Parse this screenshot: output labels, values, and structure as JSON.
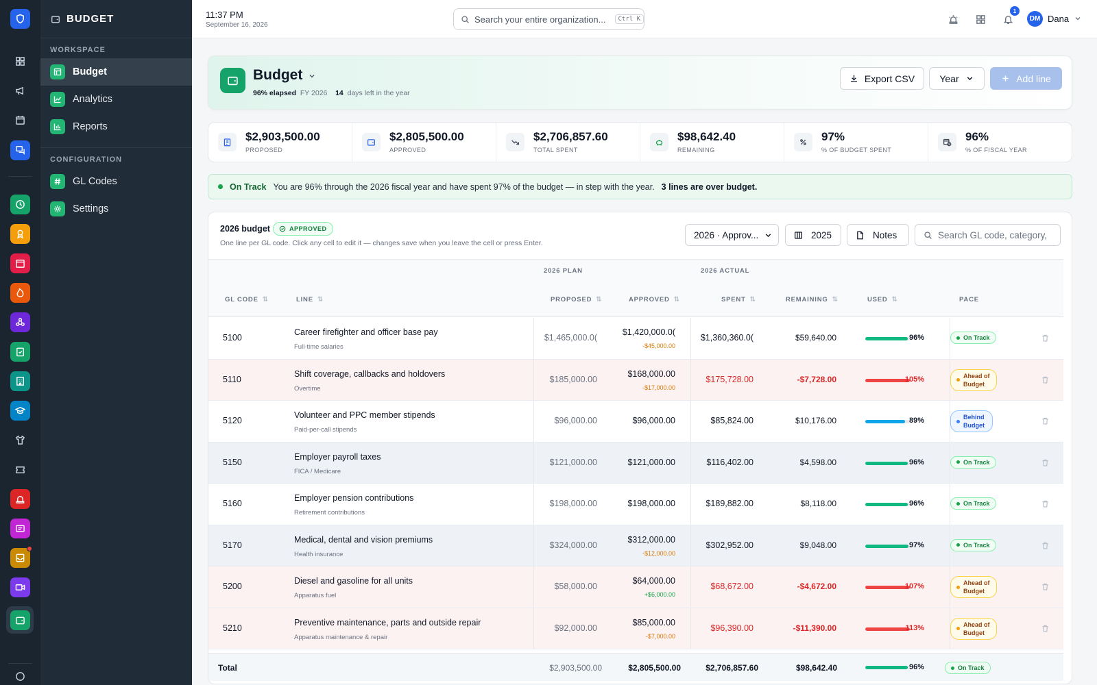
{
  "topbar": {
    "time": "11:37 PM",
    "date": "September 16, 2026",
    "search_placeholder": "Search your entire organization...",
    "search_shortcut": "Ctrl K",
    "notification_count": "1",
    "user_initials": "DM",
    "user_name": "Dana"
  },
  "nav": {
    "title": "BUDGET",
    "sections": [
      {
        "label": "WORKSPACE"
      },
      {
        "label": "CONFIGURATION"
      }
    ],
    "items": [
      {
        "label": "Budget"
      },
      {
        "label": "Analytics"
      },
      {
        "label": "Reports"
      },
      {
        "label": "GL Codes"
      },
      {
        "label": "Settings"
      }
    ]
  },
  "hero": {
    "title": "Budget",
    "elapsed": "96% elapsed",
    "fiscal_year": "FY 2026",
    "days_left": "14",
    "days_left_text": "days left in the year",
    "export_label": "Export CSV",
    "period_label": "Year",
    "add_label": "Add line"
  },
  "stats": [
    {
      "value": "$2,903,500.00",
      "label": "PROPOSED",
      "icon": "clipboard-icon"
    },
    {
      "value": "$2,805,500.00",
      "label": "APPROVED",
      "icon": "wallet-icon"
    },
    {
      "value": "$2,706,857.60",
      "label": "TOTAL SPENT",
      "icon": "trend-down-icon"
    },
    {
      "value": "$98,642.40",
      "label": "REMAINING",
      "icon": "piggy-bank-icon"
    },
    {
      "value": "97%",
      "label": "% OF BUDGET SPENT",
      "icon": "percent-icon"
    },
    {
      "value": "96%",
      "label": "% OF FISCAL YEAR",
      "icon": "calendar-clock-icon"
    }
  ],
  "alert": {
    "status": "On Track",
    "message": "You are 96% through the 2026 fiscal year and have spent 97% of the budget — in step with the year.",
    "over_budget": "3 lines are over budget."
  },
  "table_card": {
    "title": "2026 budget",
    "status_badge": "APPROVED",
    "subtitle": "One line per GL code. Click any cell to edit it — changes save when you leave the cell or press Enter.",
    "version_select": "2026 · Approv...",
    "compare_year": "2025",
    "notes_label": "Notes",
    "search_placeholder": "Search GL code, category,"
  },
  "table": {
    "group_plan": "2026 PLAN",
    "group_actual": "2026 ACTUAL",
    "headers": {
      "gl_code": "GL CODE",
      "line": "LINE",
      "proposed": "PROPOSED",
      "approved": "APPROVED",
      "spent": "SPENT",
      "remaining": "REMAINING",
      "used": "USED",
      "pace": "PACE"
    },
    "rows": [
      {
        "gl": "5100",
        "line": "Career firefighter and officer base pay",
        "sub": "Full-time salaries",
        "proposed": "$1,465,000.0(",
        "approved": "$1,420,000.0(",
        "delta": "-$45,000.00",
        "delta_type": "neg",
        "spent": "$1,360,360.0(",
        "remaining": "$59,640.00",
        "used_pct": 96,
        "used": "96%",
        "pace": "On Track",
        "pace_type": "green",
        "row_type": "normal"
      },
      {
        "gl": "5110",
        "line": "Shift coverage, callbacks and holdovers",
        "sub": "Overtime",
        "proposed": "$185,000.00",
        "approved": "$168,000.00",
        "delta": "-$17,000.00",
        "delta_type": "neg",
        "spent": "$175,728.00",
        "remaining": "-$7,728.00",
        "used_pct": 105,
        "used": "105%",
        "pace": "Ahead of Budget",
        "pace_type": "amber",
        "row_type": "over"
      },
      {
        "gl": "5120",
        "line": "Volunteer and PPC member stipends",
        "sub": "Paid-per-call stipends",
        "proposed": "$96,000.00",
        "approved": "$96,000.00",
        "delta": "",
        "delta_type": "",
        "spent": "$85,824.00",
        "remaining": "$10,176.00",
        "used_pct": 89,
        "used": "89%",
        "pace": "Behind Budget",
        "pace_type": "blue",
        "row_type": "normal"
      },
      {
        "gl": "5150",
        "line": "Employer payroll taxes",
        "sub": "FICA / Medicare",
        "proposed": "$121,000.00",
        "approved": "$121,000.00",
        "delta": "",
        "delta_type": "",
        "spent": "$116,402.00",
        "remaining": "$4,598.00",
        "used_pct": 96,
        "used": "96%",
        "pace": "On Track",
        "pace_type": "green",
        "row_type": "alt"
      },
      {
        "gl": "5160",
        "line": "Employer pension contributions",
        "sub": "Retirement contributions",
        "proposed": "$198,000.00",
        "approved": "$198,000.00",
        "delta": "",
        "delta_type": "",
        "spent": "$189,882.00",
        "remaining": "$8,118.00",
        "used_pct": 96,
        "used": "96%",
        "pace": "On Track",
        "pace_type": "green",
        "row_type": "normal"
      },
      {
        "gl": "5170",
        "line": "Medical, dental and vision premiums",
        "sub": "Health insurance",
        "proposed": "$324,000.00",
        "approved": "$312,000.00",
        "delta": "-$12,000.00",
        "delta_type": "neg",
        "spent": "$302,952.00",
        "remaining": "$9,048.00",
        "used_pct": 97,
        "used": "97%",
        "pace": "On Track",
        "pace_type": "green",
        "row_type": "alt"
      },
      {
        "gl": "5200",
        "line": "Diesel and gasoline for all units",
        "sub": "Apparatus fuel",
        "proposed": "$58,000.00",
        "approved": "$64,000.00",
        "delta": "+$6,000.00",
        "delta_type": "pos",
        "spent": "$68,672.00",
        "remaining": "-$4,672.00",
        "used_pct": 107,
        "used": "107%",
        "pace": "Ahead of Budget",
        "pace_type": "amber",
        "row_type": "over"
      },
      {
        "gl": "5210",
        "line": "Preventive maintenance, parts and outside repair",
        "sub": "Apparatus maintenance & repair",
        "proposed": "$92,000.00",
        "approved": "$85,000.00",
        "delta": "-$7,000.00",
        "delta_type": "neg",
        "spent": "$96,390.00",
        "remaining": "-$11,390.00",
        "used_pct": 113,
        "used": "113%",
        "pace": "Ahead of Budget",
        "pace_type": "amber",
        "row_type": "over"
      }
    ],
    "total": {
      "label": "Total",
      "proposed": "$2,903,500.00",
      "approved": "$2,805,500.00",
      "spent": "$2,706,857.60",
      "remaining": "$98,642.40",
      "used_pct": 96,
      "used": "96%",
      "pace": "On Track"
    }
  },
  "colors": {
    "accent": "#16a36a",
    "primary_blue": "#2563eb",
    "over_budget_red": "#dc2626",
    "sidebar_dark": "#202c38"
  }
}
